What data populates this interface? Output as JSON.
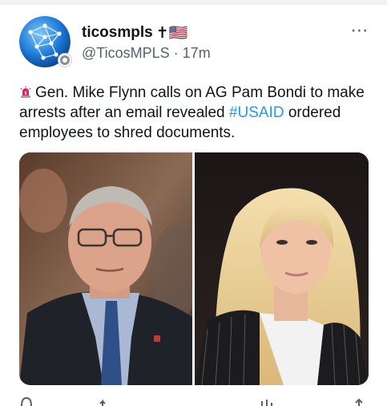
{
  "post": {
    "display_name": "ticosmpls",
    "name_suffix": "✝🇺🇸",
    "handle": "@TicosMPLS",
    "separator": "·",
    "time": "17m",
    "more_icon": "⋯",
    "text_before_hashtag": "Gen. Mike Flynn calls on AG Pam Bondi to make arrests after an email revealed ",
    "hashtag": "#USAID",
    "text_after_hashtag": " ordered employees to shred documents."
  },
  "icons": {
    "siren": "police-siren-icon",
    "avatar": "globe-network-avatar",
    "more": "more-options-icon"
  },
  "colors": {
    "hashtag": "#1d9bf0",
    "handle": "#536471",
    "siren_red": "#e0245e"
  }
}
